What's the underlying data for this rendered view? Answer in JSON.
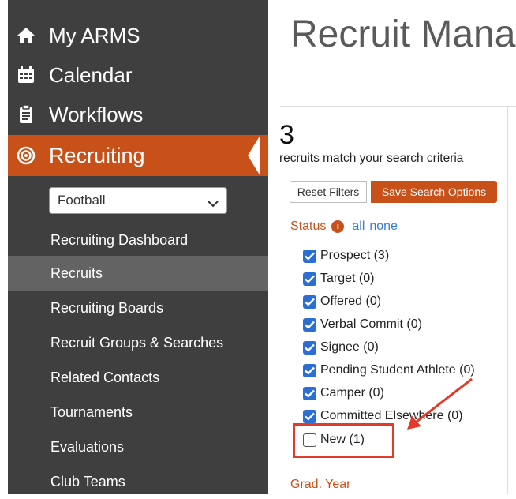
{
  "sidebar": {
    "nav": [
      {
        "label": "My ARMS",
        "icon": "home-icon"
      },
      {
        "label": "Calendar",
        "icon": "calendar-icon"
      },
      {
        "label": "Workflows",
        "icon": "clipboard-icon"
      },
      {
        "label": "Recruiting",
        "icon": "target-icon",
        "active": true
      }
    ],
    "sport_select": {
      "value": "Football"
    },
    "sub_items": [
      {
        "label": "Recruiting Dashboard"
      },
      {
        "label": "Recruits",
        "selected": true
      },
      {
        "label": "Recruiting Boards"
      },
      {
        "label": "Recruit Groups & Searches"
      },
      {
        "label": "Related Contacts"
      },
      {
        "label": "Tournaments"
      },
      {
        "label": "Evaluations"
      },
      {
        "label": "Club Teams"
      }
    ]
  },
  "main": {
    "title": "Recruit Mana",
    "count": "3",
    "match_text": "recruits match your search criteria",
    "buttons": {
      "reset": "Reset Filters",
      "save": "Save Search Options"
    },
    "status": {
      "label": "Status",
      "all": "all",
      "none": "none",
      "options": [
        {
          "label": "Prospect (3)",
          "checked": true
        },
        {
          "label": "Target (0)",
          "checked": true
        },
        {
          "label": "Offered (0)",
          "checked": true
        },
        {
          "label": "Verbal Commit (0)",
          "checked": true
        },
        {
          "label": "Signee (0)",
          "checked": true
        },
        {
          "label": "Pending Student Athlete (0)",
          "checked": true
        },
        {
          "label": "Camper (0)",
          "checked": true
        },
        {
          "label": "Committed Elsewhere (0)",
          "checked": true
        },
        {
          "label": "New (1)",
          "checked": false
        }
      ]
    },
    "grad_year_label": "Grad. Year"
  },
  "colors": {
    "sidebar_bg": "#3f3f3f",
    "accent": "#c8511a",
    "checkbox_blue": "#2b6fd6",
    "annotation_red": "#e23b2b",
    "link_blue": "#3a7bd5"
  }
}
